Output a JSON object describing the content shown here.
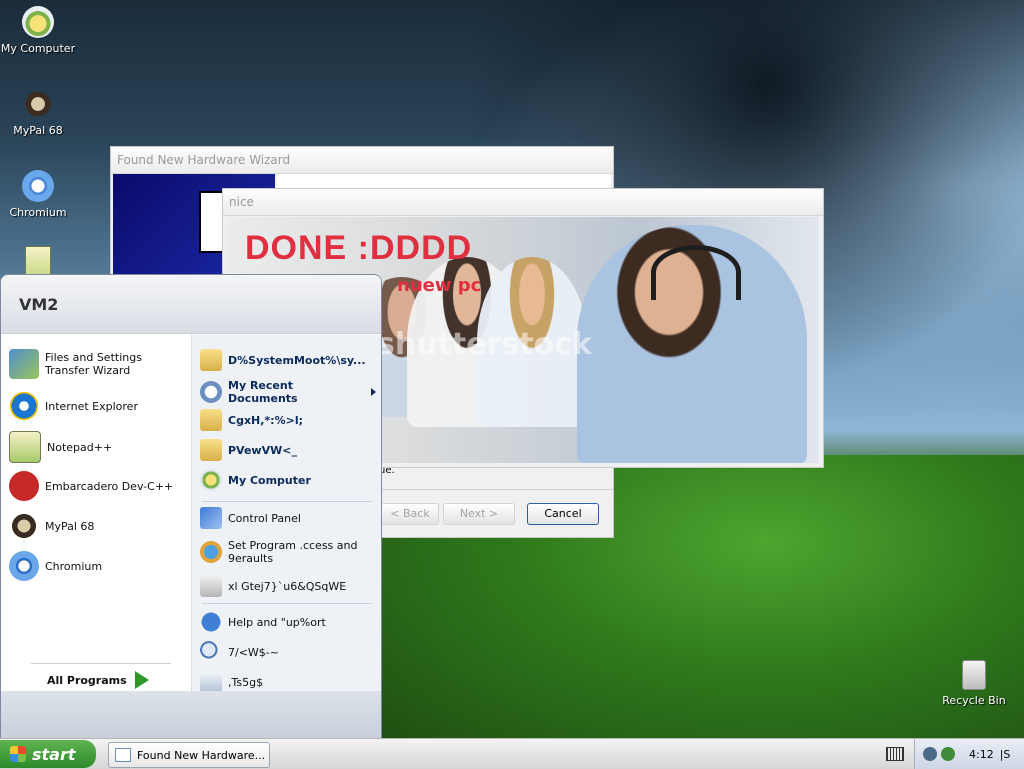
{
  "desktop": {
    "icons": [
      {
        "label": "My Computer"
      },
      {
        "label": "MyPal 68"
      },
      {
        "label": "Chromium"
      },
      {
        "label": "Recycle Bin"
      }
    ]
  },
  "wizard_window": {
    "title": "Found New Hardware Wizard",
    "fragment_number": "2",
    "fragment_text": "ue.",
    "back_label": "< Back",
    "next_label": "Next >",
    "cancel_label": "Cancel"
  },
  "nice_window": {
    "title": "nice",
    "headline": "DONE :DDDD",
    "subline": "nuew pc",
    "watermark": "shutterstock"
  },
  "start_menu": {
    "user": "VM2",
    "left_items": [
      {
        "label": "Files and Settings Transfer Wizard",
        "icon": "transfer-wizard-icon"
      },
      {
        "label": "Internet Explorer",
        "icon": "internet-explorer-icon"
      },
      {
        "label": "Notepad++",
        "icon": "notepad-plus-icon"
      },
      {
        "label": "Embarcadero Dev-C++",
        "icon": "devcpp-icon"
      },
      {
        "label": "MyPal 68",
        "icon": "mypal-icon"
      },
      {
        "label": "Chromium",
        "icon": "chromium-icon"
      }
    ],
    "all_programs": "All Programs",
    "right_items": [
      {
        "label": "D%SystemMoot%\\sy...",
        "bold": true
      },
      {
        "label": "My Recent Documents",
        "bold": true
      },
      {
        "label": "CgxH,*:%>l;",
        "bold": true
      },
      {
        "label": "PVewVW<_",
        "bold": true
      },
      {
        "label": "My Computer",
        "bold": true
      },
      {
        "label": "Control Panel",
        "bold": false
      },
      {
        "label": "Set Program .ccess and 9eraults",
        "bold": false
      },
      {
        "label": "xl Gtej7}`u6&QSqWE",
        "bold": false
      },
      {
        "label": "Help and \"up%ort",
        "bold": false
      },
      {
        "label": "7/<W$-~",
        "bold": false
      },
      {
        "label": ",Ts5g$",
        "bold": false
      }
    ]
  },
  "taskbar": {
    "start_label": "start",
    "task_label": "Found New Hardware...",
    "clock": "4:12",
    "tray_extra": "|S"
  },
  "colors": {
    "start_green": "#3c9a34",
    "headline_red": "#e03040",
    "right_pane_blue": "#0b2a5c"
  }
}
